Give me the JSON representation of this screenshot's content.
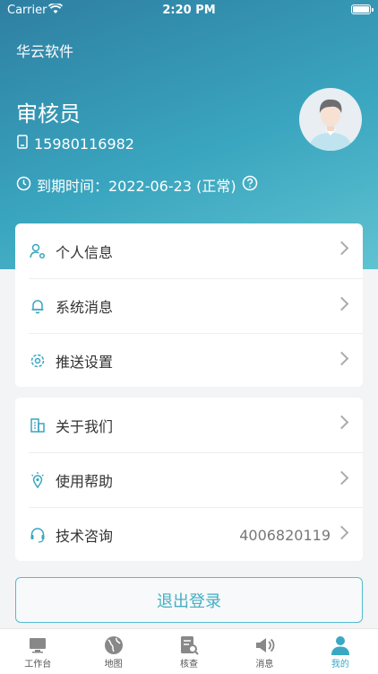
{
  "status_bar": {
    "carrier": "Carrier",
    "time": "2:20 PM"
  },
  "header": {
    "company": "华云软件",
    "role": "审核员",
    "phone": "15980116982",
    "expire": "到期时间：2022-06-23 (正常)"
  },
  "menu_group1": [
    {
      "label": "个人信息",
      "icon": "user-gear-icon"
    },
    {
      "label": "系统消息",
      "icon": "bell-icon"
    },
    {
      "label": "推送设置",
      "icon": "gear-icon"
    }
  ],
  "menu_group2": [
    {
      "label": "关于我们",
      "icon": "building-icon"
    },
    {
      "label": "使用帮助",
      "icon": "help-pin-icon"
    },
    {
      "label": "技术咨询",
      "icon": "headset-icon",
      "value": "4006820119"
    }
  ],
  "logout_label": "退出登录",
  "tabs": [
    {
      "label": "工作台",
      "icon": "desktop-icon",
      "active": false
    },
    {
      "label": "地图",
      "icon": "globe-icon",
      "active": false
    },
    {
      "label": "核查",
      "icon": "inspect-icon",
      "active": false
    },
    {
      "label": "消息",
      "icon": "megaphone-icon",
      "active": false
    },
    {
      "label": "我的",
      "icon": "person-icon",
      "active": true
    }
  ],
  "colors": {
    "accent": "#3aa5bf",
    "header_start": "#2e7fa2",
    "header_end": "#5fc3d1"
  }
}
